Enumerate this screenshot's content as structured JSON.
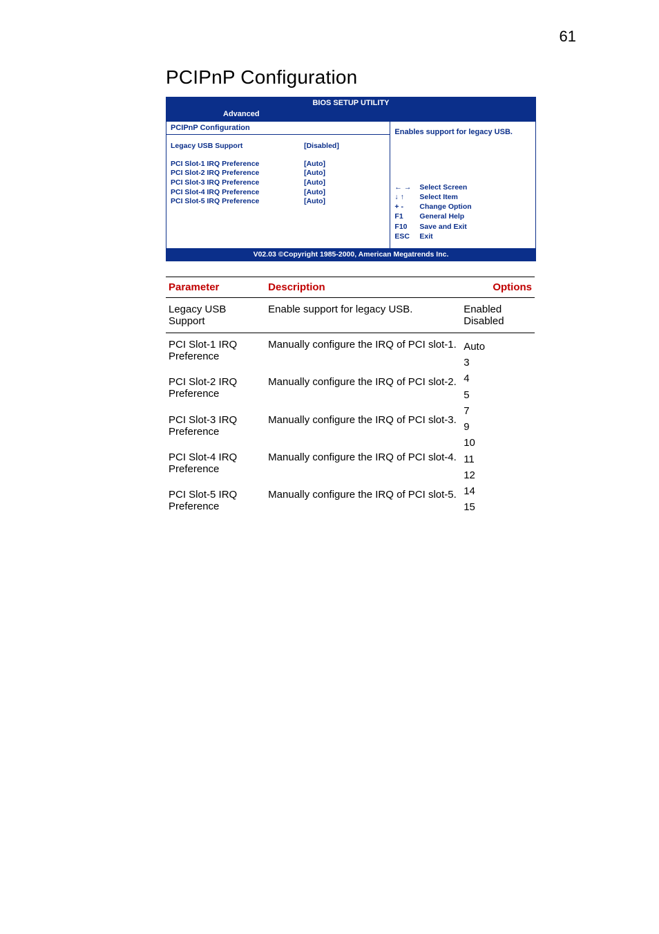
{
  "page_number": "61",
  "heading": "PCIPnP Configuration",
  "bios": {
    "titlebar": "BIOS SETUP UTILITY",
    "tab": "Advanced",
    "panel_title": "PCIPnP Configuration",
    "rows": [
      {
        "label": "Legacy USB Support",
        "value": "[Disabled]"
      },
      {
        "label": "PCI Slot-1 IRQ Preference",
        "value": "[Auto]"
      },
      {
        "label": "PCI Slot-2 IRQ Preference",
        "value": "[Auto]"
      },
      {
        "label": "PCI Slot-3 IRQ Preference",
        "value": "[Auto]"
      },
      {
        "label": "PCI Slot-4 IRQ Preference",
        "value": "[Auto]"
      },
      {
        "label": "PCI Slot-5 IRQ Preference",
        "value": "[Auto]"
      }
    ],
    "help": "Enables support for legacy USB.",
    "nav": [
      {
        "key": "← →",
        "label": "Select Screen"
      },
      {
        "key": "↓ ↑",
        "label": "Select Item"
      },
      {
        "key": "+ -",
        "label": "Change Option"
      },
      {
        "key": "F1",
        "label": "General Help"
      },
      {
        "key": "F10",
        "label": "Save and Exit"
      },
      {
        "key": "ESC",
        "label": "Exit"
      }
    ],
    "footer": "V02.03 ©Copyright 1985-2000, American Megatrends Inc."
  },
  "table": {
    "headers": {
      "param": "Parameter",
      "desc": "Description",
      "opts": "Options"
    },
    "legacy": {
      "param": "Legacy USB Support",
      "desc": "Enable support for legacy USB.",
      "opts_line1": "Enabled",
      "opts_line2": "Disabled"
    },
    "irq_opts": [
      "Auto",
      "3",
      "4",
      "5",
      "7",
      "9",
      "10",
      "11",
      "12",
      "14",
      "15"
    ],
    "irq": [
      {
        "param": "PCI Slot-1 IRQ Preference",
        "desc": "Manually configure the IRQ of PCI slot-1."
      },
      {
        "param": "PCI Slot-2 IRQ Preference",
        "desc": "Manually configure the IRQ of PCI slot-2."
      },
      {
        "param": "PCI Slot-3 IRQ Preference",
        "desc": "Manually configure the IRQ of PCI slot-3."
      },
      {
        "param": "PCI Slot-4 IRQ Preference",
        "desc": "Manually configure the IRQ of PCI slot-4."
      },
      {
        "param": "PCI Slot-5 IRQ Preference",
        "desc": "Manually configure the IRQ of PCI slot-5."
      }
    ]
  }
}
